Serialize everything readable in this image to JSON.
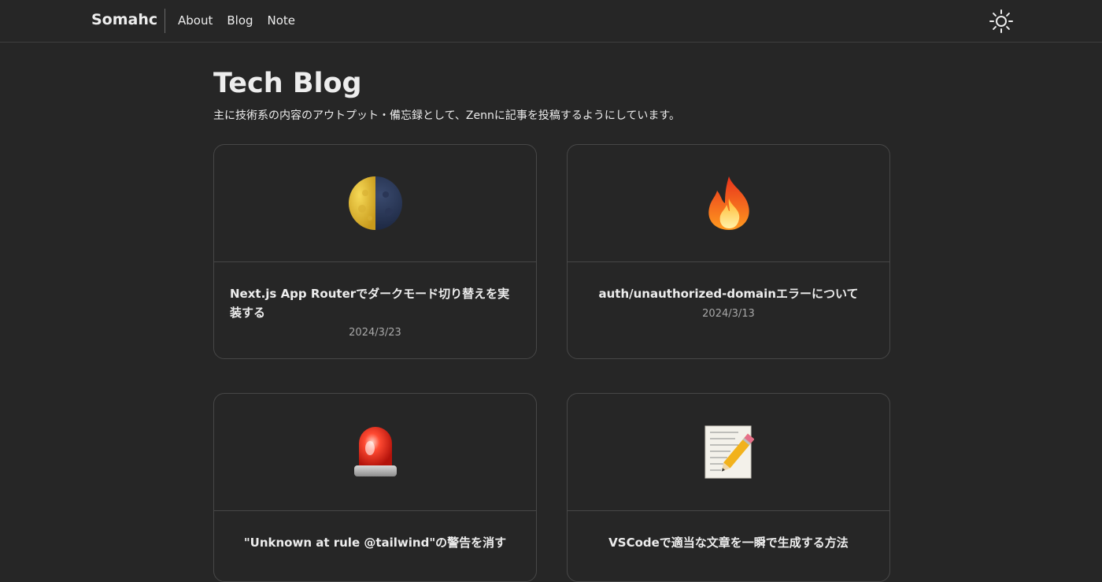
{
  "header": {
    "brand": "Somahc",
    "nav": [
      {
        "label": "About"
      },
      {
        "label": "Blog"
      },
      {
        "label": "Note"
      }
    ],
    "theme_icon": "sun-icon"
  },
  "page": {
    "title": "Tech Blog",
    "description": "主に技術系の内容のアウトプット・備忘録として、Zennに記事を投稿するようにしています。"
  },
  "articles": [
    {
      "emoji": "🌗",
      "title": "Next.js App Routerでダークモード切り替えを実装する",
      "date": "2024/3/23"
    },
    {
      "emoji": "🔥",
      "title": "auth/unauthorized-domainエラーについて",
      "date": "2024/3/13"
    },
    {
      "emoji": "🚨",
      "title": "\"Unknown at rule @tailwind\"の警告を消す",
      "date": ""
    },
    {
      "emoji": "📝",
      "title": "VSCodeで適当な文章を一瞬で生成する方法",
      "date": ""
    }
  ],
  "colors": {
    "background": "#262626",
    "border": "#474747",
    "text": "#ededed",
    "muted": "#a8a8a8"
  }
}
